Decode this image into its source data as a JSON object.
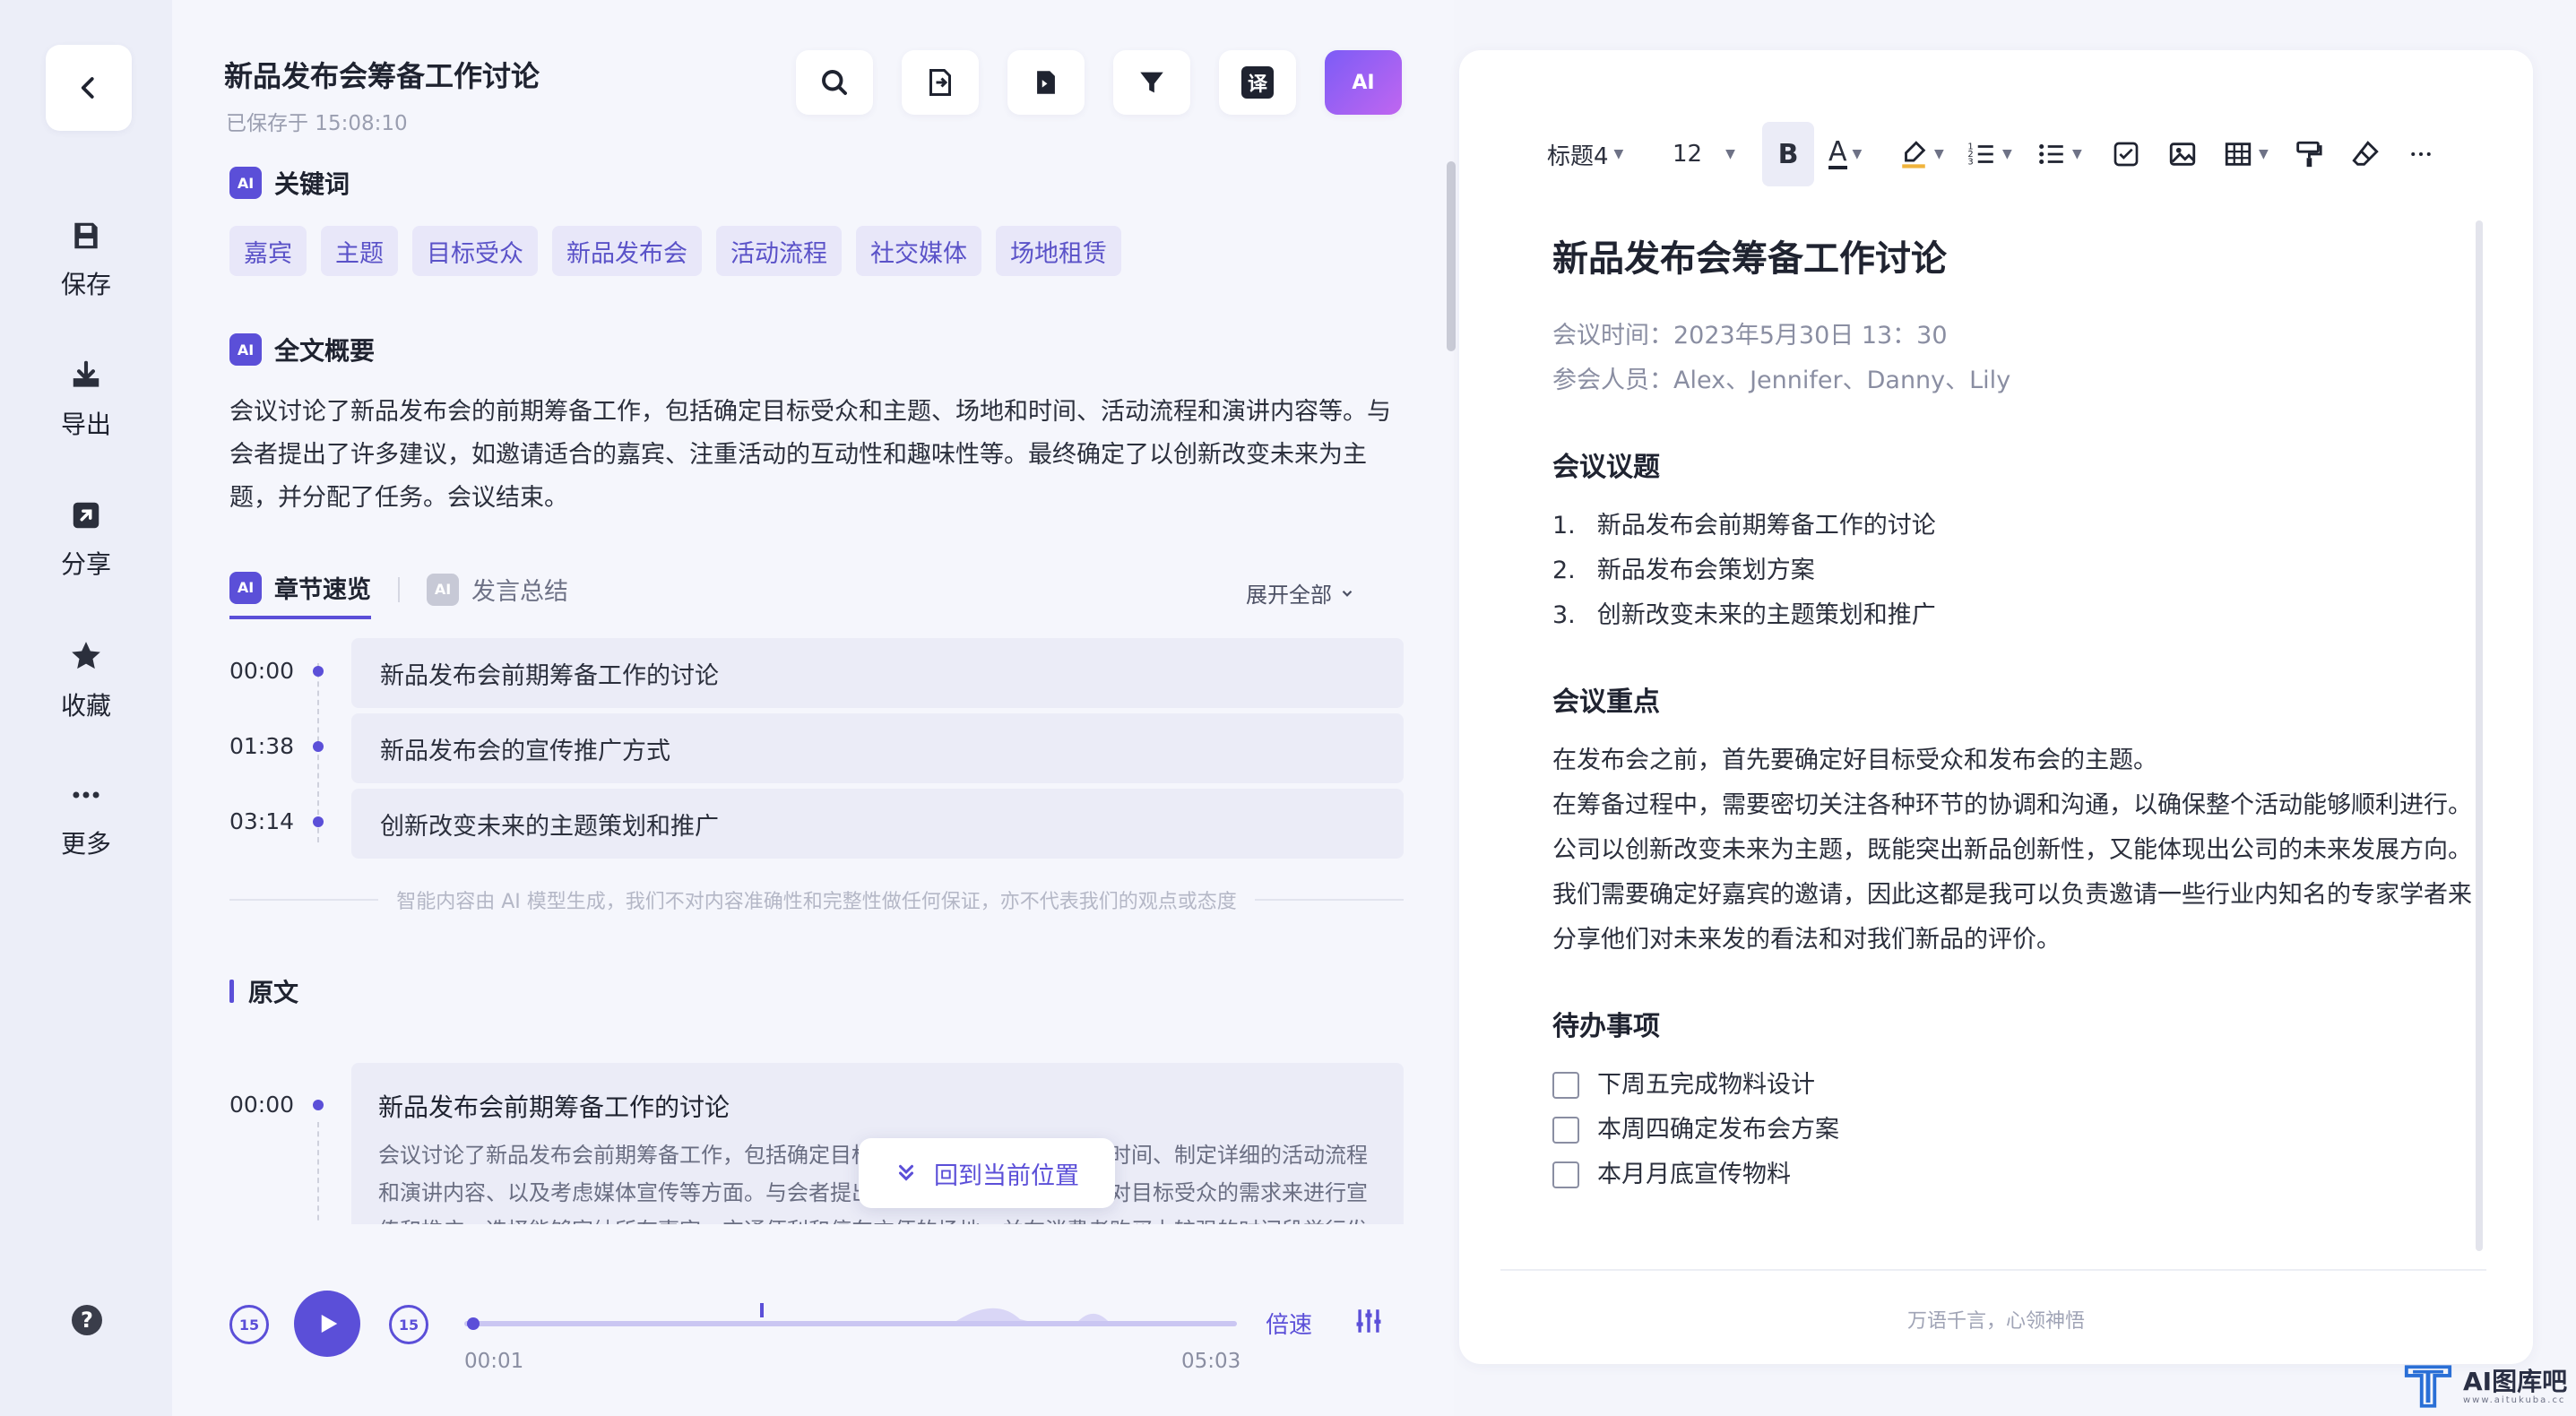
{
  "sidebar": {
    "items": [
      {
        "label": "保存",
        "icon": "save-icon"
      },
      {
        "label": "导出",
        "icon": "download-icon"
      },
      {
        "label": "分享",
        "icon": "share-icon"
      },
      {
        "label": "收藏",
        "icon": "star-icon"
      },
      {
        "label": "更多",
        "icon": "more-icon"
      }
    ]
  },
  "header": {
    "title": "新品发布会筹备工作讨论",
    "saved": "已保存于 15:08:10",
    "tools": [
      "search-icon",
      "doc-convert-icon",
      "export-icon",
      "filter-icon",
      "translate-icon",
      "ai-icon"
    ],
    "translate_glyph": "译",
    "ai_glyph": "AI"
  },
  "keywords": {
    "title": "关键词",
    "tags": [
      "嘉宾",
      "主题",
      "目标受众",
      "新品发布会",
      "活动流程",
      "社交媒体",
      "场地租赁"
    ]
  },
  "summary": {
    "title": "全文概要",
    "text": "会议讨论了新品发布会的前期筹备工作，包括确定目标受众和主题、场地和时间、活动流程和演讲内容等。与会者提出了许多建议，如邀请适合的嘉宾、注重活动的互动性和趣味性等。最终确定了以创新改变未来为主题，并分配了任务。会议结束。"
  },
  "tabs": {
    "active": "章节速览",
    "inactive": "发言总结",
    "expand": "展开全部"
  },
  "chapters": [
    {
      "time": "00:00",
      "title": "新品发布会前期筹备工作的讨论"
    },
    {
      "time": "01:38",
      "title": "新品发布会的宣传推广方式"
    },
    {
      "time": "03:14",
      "title": "创新改变未来的主题策划和推广"
    }
  ],
  "disclaimer": "智能内容由 AI 模型生成，我们不对内容准确性和完整性做任何保证，亦不代表我们的观点或态度",
  "original": {
    "title": "原文",
    "time": "00:00",
    "block_title": "新品发布会前期筹备工作的讨论",
    "block_text": "会议讨论了新品发布会前期筹备工作，包括确定目标受众和主题、选择场地和时间、制定详细的活动流程和演讲内容、以及考虑媒体宣传等方面。与会者提出了许多建议，例如需要针对目标受众的需求来进行宣传和推广，选择能够容纳所有嘉宾、交通便利和停车方便的场地，并在消费者购买力较强的时间段举行发布会，同"
  },
  "back_to_current": "回到当前位置",
  "player": {
    "current": "00:01",
    "duration": "05:03",
    "progress": 0.003,
    "speed": "倍速",
    "skip_back": "15",
    "skip_fwd": "15"
  },
  "editor": {
    "toolbar": {
      "heading": "标题4",
      "size": "12",
      "bold": "B",
      "font_color": "A"
    },
    "title": "新品发布会筹备工作讨论",
    "meta": [
      "会议时间：2023年5月30日 13：30",
      "参会人员：Alex、Jennifer、Danny、Lily"
    ],
    "agenda_title": "会议议题",
    "agenda": [
      {
        "num": "1.",
        "text": "新品发布会前期筹备工作的讨论"
      },
      {
        "num": "2.",
        "text": "新品发布会策划方案"
      },
      {
        "num": "3.",
        "text": "创新改变未来的主题策划和推广"
      }
    ],
    "keypoints_title": "会议重点",
    "keypoints": [
      "在发布会之前，首先要确定好目标受众和发布会的主题。",
      "在筹备过程中，需要密切关注各种环节的协调和沟通，以确保整个活动能够顺利进行。",
      "公司以创新改变未来为主题，既能突出新品创新性，又能体现出公司的未来发展方向。",
      "我们需要确定好嘉宾的邀请，因此这都是我可以负责邀请一些行业内知名的专家学者来分享他们对未来发的看法和对我们新品的评价。"
    ],
    "todo_title": "待办事项",
    "todos": [
      "下周五完成物料设计",
      "本周四确定发布会方案",
      "本月月底宣传物料"
    ],
    "footer": "万语千言，心领神悟"
  },
  "watermark": {
    "brand": "AI图库吧",
    "sub": "www.aitukuba.cc"
  },
  "colors": {
    "accent": "#5b4fd8",
    "tag_bg": "#e8e7f9",
    "ai_gradient_start": "#7c5cf6",
    "ai_gradient_end": "#c066f0"
  }
}
